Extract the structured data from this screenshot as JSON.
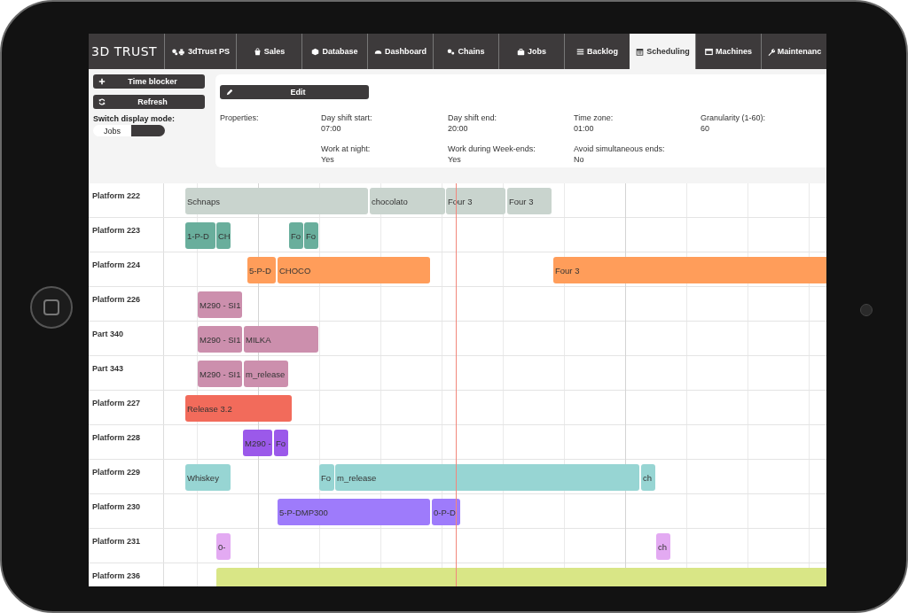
{
  "nav": {
    "logo": "3D TRUST",
    "site": "3dTrust PS",
    "tabs": [
      {
        "label": "Sales",
        "selected": false
      },
      {
        "label": "Database",
        "selected": false
      },
      {
        "label": "Dashboard",
        "selected": false
      },
      {
        "label": "Chains",
        "selected": false
      },
      {
        "label": "Jobs",
        "selected": false
      },
      {
        "label": "Backlog",
        "selected": false
      },
      {
        "label": "Scheduling",
        "selected": true
      },
      {
        "label": "Machines",
        "selected": false
      },
      {
        "label": "Maintenanc",
        "selected": false
      }
    ]
  },
  "actions": [
    {
      "label": "Time blocker"
    },
    {
      "label": "Refresh"
    }
  ],
  "display_mode": {
    "label": "Switch display mode:",
    "option": "Jobs",
    "on": false
  },
  "properties": {
    "edit_label": "Edit",
    "title": "Properties:",
    "fields": [
      {
        "label": "Day shift start:",
        "value": "07:00"
      },
      {
        "label": "Day shift end:",
        "value": "20:00"
      },
      {
        "label": "Time zone:",
        "value": "01:00"
      },
      {
        "label": "Granularity (1-60):",
        "value": "60"
      },
      {
        "label": "Work at night:",
        "value": "Yes"
      },
      {
        "label": "Work during Week-ends:",
        "value": "Yes"
      },
      {
        "label": "Avoid simultaneous ends:",
        "value": "No"
      }
    ]
  },
  "schedule": {
    "rows": [
      {
        "name": "Platform 222",
        "color": "#c9d4ce",
        "jobs": [
          "Schnaps",
          "chocolato",
          "Four 3",
          "Four 3"
        ]
      },
      {
        "name": "Platform 223",
        "color": "#69ae9c",
        "jobs": [
          "1-P-D",
          "CH",
          "Fo",
          "Fo"
        ]
      },
      {
        "name": "Platform 224",
        "color": "#ff9d5a",
        "jobs": [
          "5-P-D",
          "CHOCO",
          "Four 3"
        ]
      },
      {
        "name": "Platform 226",
        "color": "#cc8fad",
        "jobs": [
          "M290 - SI1"
        ]
      },
      {
        "name": "Part 340",
        "color": "#cc8fad",
        "jobs": [
          "M290 - SI1",
          "MILKA"
        ]
      },
      {
        "name": "Part 343",
        "color": "#cc8fad",
        "jobs": [
          "M290 - SI1",
          "m_release"
        ]
      },
      {
        "name": "Platform 227",
        "color": "#f26b5b",
        "jobs": [
          "Release 3.2"
        ]
      },
      {
        "name": "Platform 228",
        "color": "#9b59ea",
        "jobs": [
          "M290 -",
          "Fo"
        ]
      },
      {
        "name": "Platform 229",
        "color": "#97d5d3",
        "jobs": [
          "Whiskey",
          "Fo",
          "m_release",
          "ch"
        ]
      },
      {
        "name": "Platform 230",
        "color": "#9e7bfb",
        "jobs": [
          "5-P-DMP300",
          "0-P-D"
        ]
      },
      {
        "name": "Platform 231",
        "color": "#e3aaf2",
        "jobs": [
          "0-",
          "ch"
        ]
      },
      {
        "name": "Platform 236",
        "color": "#d9e686"
      }
    ]
  }
}
